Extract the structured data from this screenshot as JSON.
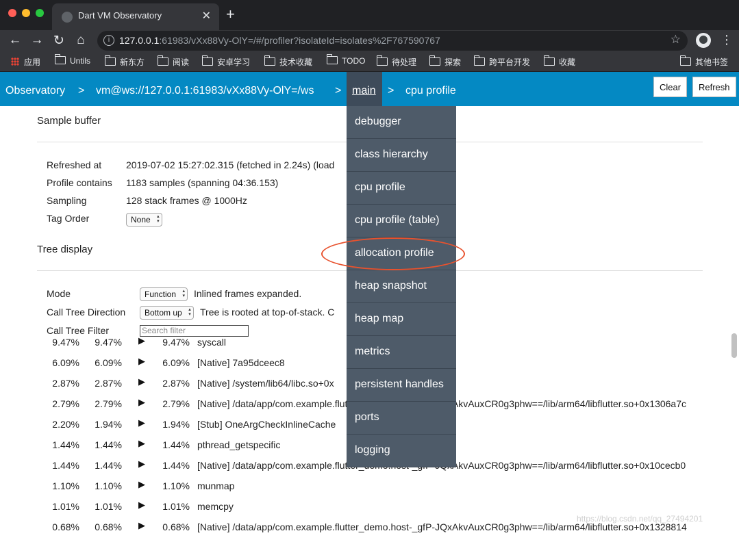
{
  "browser": {
    "tab_title": "Dart VM Observatory",
    "tab_close": "✕",
    "new_tab": "+",
    "nav": {
      "back": "←",
      "forward": "→",
      "reload": "↻",
      "home": "⌂"
    },
    "url_info": "i",
    "url_host": "127.0.0.1",
    "url_rest": ":61983/vXx88Vy-OlY=/#/profiler?isolateId=isolates%2F767590767",
    "star": "☆",
    "menu": "⋮",
    "bookmarks": [
      {
        "label": "应用",
        "icon": "apps-grid-icon"
      },
      {
        "label": "Untils",
        "icon": "folder-icon"
      },
      {
        "label": "新东方",
        "icon": "folder-icon"
      },
      {
        "label": "阅读",
        "icon": "folder-icon"
      },
      {
        "label": "安卓学习",
        "icon": "folder-icon"
      },
      {
        "label": "技术收藏",
        "icon": "folder-icon"
      },
      {
        "label": "TODO",
        "icon": "folder-icon"
      },
      {
        "label": "待处理",
        "icon": "folder-icon"
      },
      {
        "label": "探索",
        "icon": "folder-icon"
      },
      {
        "label": "跨平台开发",
        "icon": "folder-icon"
      },
      {
        "label": "收藏",
        "icon": "folder-icon"
      },
      {
        "label": "其他书签",
        "icon": "folder-icon"
      }
    ]
  },
  "observatory_nav": {
    "root": "Observatory",
    "vm": "vm@ws://127.0.0.1:61983/vXx88Vy-OlY=/ws",
    "isolate": "main",
    "page": "cpu profile",
    "separator": ">",
    "clear_label": "Clear",
    "refresh_label": "Refresh"
  },
  "dropdown": {
    "items": [
      "debugger",
      "class hierarchy",
      "cpu profile",
      "cpu profile (table)",
      "allocation profile",
      "heap snapshot",
      "heap map",
      "metrics",
      "persistent handles",
      "ports",
      "logging"
    ],
    "highlighted": "allocation profile",
    "highlight_color": "#e8522e"
  },
  "sample_buffer": {
    "title": "Sample buffer",
    "refreshed_label": "Refreshed at",
    "refreshed_value": "2019-07-02 15:27:02.315 (fetched in 2.24s) (load",
    "contains_label": "Profile contains",
    "contains_value": "1183 samples (spanning 04:36.153)",
    "sampling_label": "Sampling",
    "sampling_value": "128 stack frames @ 1000Hz",
    "tag_order_label": "Tag Order",
    "tag_order_value": "None"
  },
  "tree_display": {
    "title": "Tree display",
    "mode_label": "Mode",
    "mode_value": "Function",
    "mode_note": "Inlined frames expanded.",
    "direction_label": "Call Tree Direction",
    "direction_value": "Bottom up",
    "direction_note": "Tree is rooted at top-of-stack. C",
    "filter_label": "Call Tree Filter",
    "filter_placeholder": "Search filter"
  },
  "tree_rows": [
    {
      "a": "9.47%",
      "b": "9.47%",
      "c": "9.47%",
      "name": "syscall"
    },
    {
      "a": "6.09%",
      "b": "6.09%",
      "c": "6.09%",
      "name": "[Native] 7a95dceec8"
    },
    {
      "a": "2.87%",
      "b": "2.87%",
      "c": "2.87%",
      "name": "[Native] /system/lib64/libc.so+0x"
    },
    {
      "a": "2.79%",
      "b": "2.79%",
      "c": "2.79%",
      "name": "[Native] /data/app/com.example.flutter_demo.host-_gfP-JQxAkvAuxCR0g3phw==/lib/arm64/libflutter.so+0x1306a7c"
    },
    {
      "a": "2.20%",
      "b": "1.94%",
      "c": "1.94%",
      "name": "[Stub] OneArgCheckInlineCache"
    },
    {
      "a": "1.44%",
      "b": "1.44%",
      "c": "1.44%",
      "name": "pthread_getspecific"
    },
    {
      "a": "1.44%",
      "b": "1.44%",
      "c": "1.44%",
      "name": "[Native] /data/app/com.example.flutter_demo.host-_gfP-JQxAkvAuxCR0g3phw==/lib/arm64/libflutter.so+0x10cecb0"
    },
    {
      "a": "1.10%",
      "b": "1.10%",
      "c": "1.10%",
      "name": "munmap"
    },
    {
      "a": "1.01%",
      "b": "1.01%",
      "c": "1.01%",
      "name": "memcpy"
    },
    {
      "a": "0.68%",
      "b": "0.68%",
      "c": "0.68%",
      "name": "[Native] /data/app/com.example.flutter_demo.host-_gfP-JQxAkvAuxCR0g3phw==/lib/arm64/libflutter.so+0x1328814"
    }
  ],
  "expand_glyph": "▶",
  "watermark": "https://blog.csdn.net/qq_27494201"
}
